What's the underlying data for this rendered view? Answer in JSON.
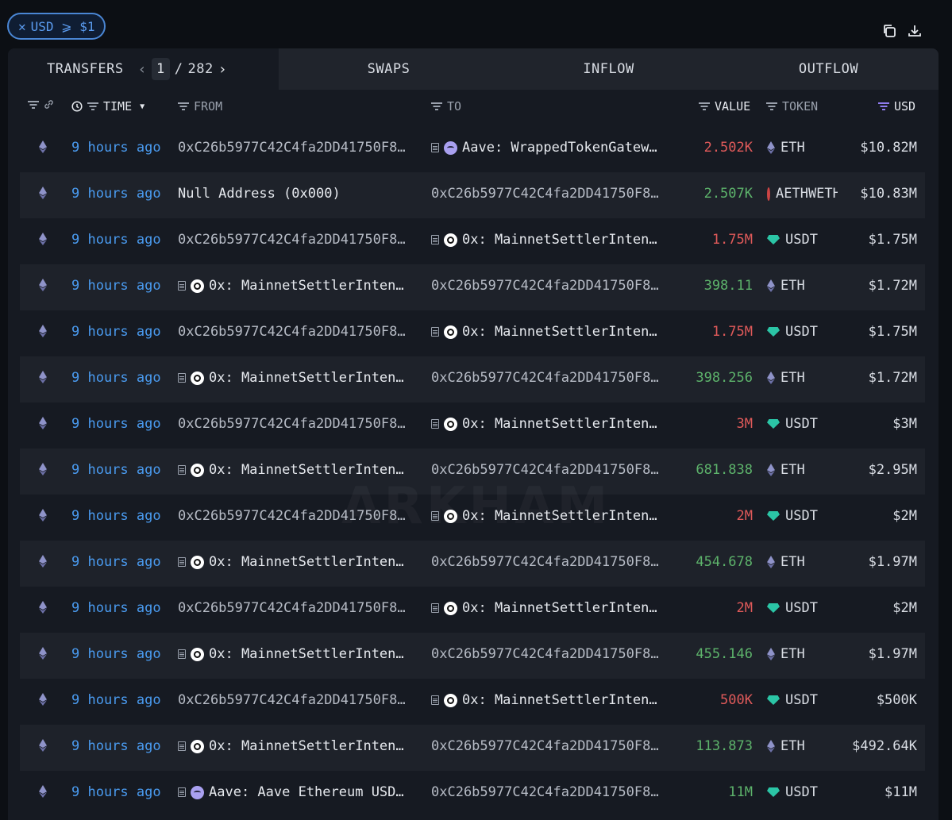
{
  "filter": {
    "label": "USD ⩾ $1",
    "close_icon": "close-icon"
  },
  "toolbar": {
    "copy_icon": "copy-icon",
    "download_icon": "download-icon"
  },
  "tabs": {
    "transfers": "TRANSFERS",
    "page_current": "1",
    "page_sep": "/",
    "page_total": "282",
    "swaps": "SWAPS",
    "inflow": "INFLOW",
    "outflow": "OUTFLOW"
  },
  "columns": {
    "time": "TIME",
    "from": "FROM",
    "to": "TO",
    "value": "VALUE",
    "token": "TOKEN",
    "usd": "USD"
  },
  "watermark": "ARKHAM",
  "colors": {
    "accent": "#4a9bf0",
    "out": "#e05a5a",
    "in": "#5db36b",
    "usdt": "#2bc5a6"
  },
  "rows": [
    {
      "time": "9 hours ago",
      "from": "0xC26b5977C42C4fa2DD41750F8…",
      "to": "Aave: WrappedTokenGatew…",
      "value": "2.502K",
      "token": "ETH",
      "usd": "$10.82M"
    },
    {
      "time": "9 hours ago",
      "from": "Null Address (0x000)",
      "to": "0xC26b5977C42C4fa2DD41750F8…",
      "value": "2.507K",
      "token": "AETHWETH",
      "usd": "$10.83M"
    },
    {
      "time": "9 hours ago",
      "from": "0xC26b5977C42C4fa2DD41750F8…",
      "to": "0x: MainnetSettlerInten…",
      "value": "1.75M",
      "token": "USDT",
      "usd": "$1.75M"
    },
    {
      "time": "9 hours ago",
      "from": "0x: MainnetSettlerInten…",
      "to": "0xC26b5977C42C4fa2DD41750F8…",
      "value": "398.11",
      "token": "ETH",
      "usd": "$1.72M"
    },
    {
      "time": "9 hours ago",
      "from": "0xC26b5977C42C4fa2DD41750F8…",
      "to": "0x: MainnetSettlerInten…",
      "value": "1.75M",
      "token": "USDT",
      "usd": "$1.75M"
    },
    {
      "time": "9 hours ago",
      "from": "0x: MainnetSettlerInten…",
      "to": "0xC26b5977C42C4fa2DD41750F8…",
      "value": "398.256",
      "token": "ETH",
      "usd": "$1.72M"
    },
    {
      "time": "9 hours ago",
      "from": "0xC26b5977C42C4fa2DD41750F8…",
      "to": "0x: MainnetSettlerInten…",
      "value": "3M",
      "token": "USDT",
      "usd": "$3M"
    },
    {
      "time": "9 hours ago",
      "from": "0x: MainnetSettlerInten…",
      "to": "0xC26b5977C42C4fa2DD41750F8…",
      "value": "681.838",
      "token": "ETH",
      "usd": "$2.95M"
    },
    {
      "time": "9 hours ago",
      "from": "0xC26b5977C42C4fa2DD41750F8…",
      "to": "0x: MainnetSettlerInten…",
      "value": "2M",
      "token": "USDT",
      "usd": "$2M"
    },
    {
      "time": "9 hours ago",
      "from": "0x: MainnetSettlerInten…",
      "to": "0xC26b5977C42C4fa2DD41750F8…",
      "value": "454.678",
      "token": "ETH",
      "usd": "$1.97M"
    },
    {
      "time": "9 hours ago",
      "from": "0xC26b5977C42C4fa2DD41750F8…",
      "to": "0x: MainnetSettlerInten…",
      "value": "2M",
      "token": "USDT",
      "usd": "$2M"
    },
    {
      "time": "9 hours ago",
      "from": "0x: MainnetSettlerInten…",
      "to": "0xC26b5977C42C4fa2DD41750F8…",
      "value": "455.146",
      "token": "ETH",
      "usd": "$1.97M"
    },
    {
      "time": "9 hours ago",
      "from": "0xC26b5977C42C4fa2DD41750F8…",
      "to": "0x: MainnetSettlerInten…",
      "value": "500K",
      "token": "USDT",
      "usd": "$500K"
    },
    {
      "time": "9 hours ago",
      "from": "0x: MainnetSettlerInten…",
      "to": "0xC26b5977C42C4fa2DD41750F8…",
      "value": "113.873",
      "token": "ETH",
      "usd": "$492.64K"
    },
    {
      "time": "9 hours ago",
      "from": "Aave: Aave Ethereum USD…",
      "to": "0xC26b5977C42C4fa2DD41750F8…",
      "value": "11M",
      "token": "USDT",
      "usd": "$11M"
    }
  ]
}
